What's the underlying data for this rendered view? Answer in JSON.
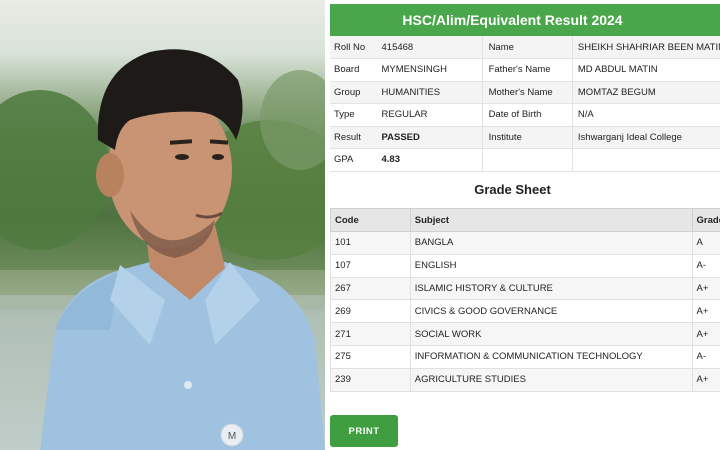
{
  "result": {
    "title": "HSC/Alim/Equivalent Result 2024",
    "info_rows": [
      {
        "k1": "Roll No",
        "v1": "415468",
        "k2": "Name",
        "v2": "SHEIKH SHAHRIAR BEEN MATIN"
      },
      {
        "k1": "Board",
        "v1": "MYMENSINGH",
        "k2": "Father's Name",
        "v2": "MD ABDUL MATIN"
      },
      {
        "k1": "Group",
        "v1": "HUMANITIES",
        "k2": "Mother's Name",
        "v2": "MOMTAZ BEGUM"
      },
      {
        "k1": "Type",
        "v1": "REGULAR",
        "k2": "Date of Birth",
        "v2": "N/A"
      },
      {
        "k1": "Result",
        "v1": "PASSED",
        "k2": "Institute",
        "v2": "Ishwarganj Ideal College"
      },
      {
        "k1": "GPA",
        "v1": "4.83",
        "k2": "",
        "v2": ""
      }
    ]
  },
  "grade_sheet": {
    "title": "Grade Sheet",
    "headers": [
      "Code",
      "Subject",
      "Grade"
    ],
    "rows": [
      {
        "code": "101",
        "subject": "BANGLA",
        "grade": "A"
      },
      {
        "code": "107",
        "subject": "ENGLISH",
        "grade": "A-"
      },
      {
        "code": "267",
        "subject": "ISLAMIC HISTORY & CULTURE",
        "grade": "A+"
      },
      {
        "code": "269",
        "subject": "CIVICS & GOOD GOVERNANCE",
        "grade": "A+"
      },
      {
        "code": "271",
        "subject": "SOCIAL WORK",
        "grade": "A+"
      },
      {
        "code": "275",
        "subject": "INFORMATION & COMMUNICATION TECHNOLOGY",
        "grade": "A-"
      },
      {
        "code": "239",
        "subject": "AGRICULTURE STUDIES",
        "grade": "A+"
      }
    ]
  },
  "actions": {
    "print_label": "PRINT"
  },
  "photo": {
    "shirt_logo": "M"
  },
  "colors": {
    "header_green": "#4aa64a",
    "button_green": "#3f9e3f"
  }
}
